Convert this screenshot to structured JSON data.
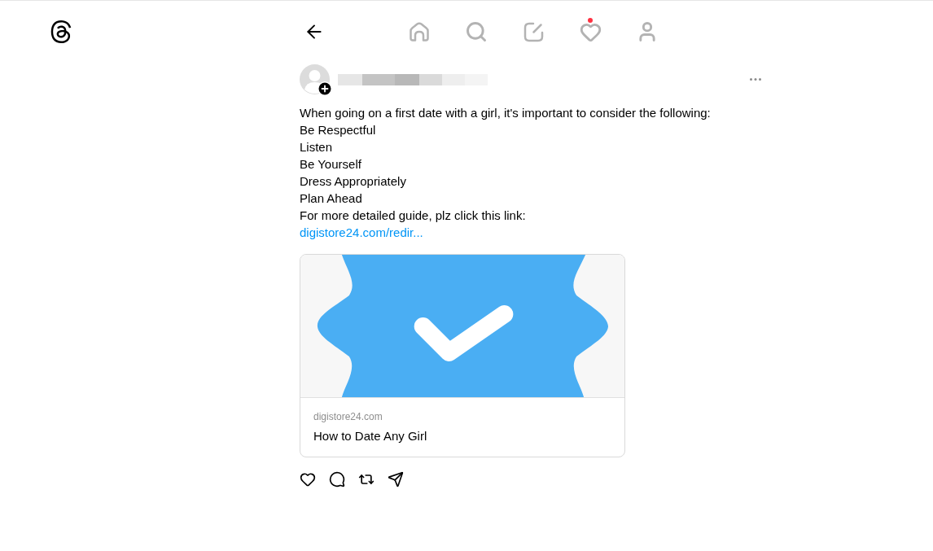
{
  "nav": {
    "items": [
      {
        "selected": false,
        "notification": false
      },
      {
        "selected": false,
        "notification": false
      },
      {
        "selected": false,
        "notification": false
      },
      {
        "selected": false,
        "notification": true
      },
      {
        "selected": false,
        "notification": false
      }
    ]
  },
  "post": {
    "text_lines": [
      "When going on a first date with a girl, it's important to consider the following:",
      "Be Respectful",
      "Listen",
      "Be Yourself",
      "Dress Appropriately",
      "Plan Ahead",
      "For more detailed guide, plz click this link:"
    ],
    "link": "digistore24.com/redir...",
    "link_preview": {
      "domain": "digistore24.com",
      "title": "How to Date Any Girl"
    }
  }
}
